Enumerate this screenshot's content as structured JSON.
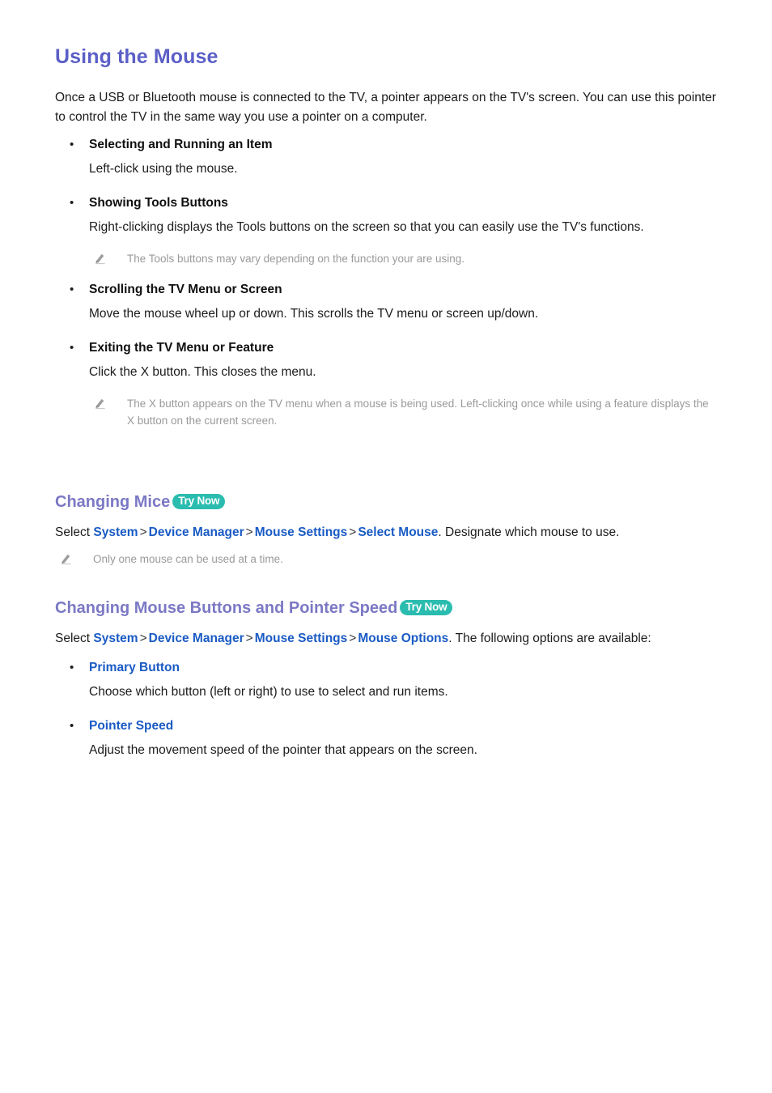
{
  "document": {
    "title": "Using the Mouse",
    "intro": "Once a USB or Bluetooth mouse is connected to the TV, a pointer appears on the TV's screen. You can use this pointer to control the TV in the same way you use a pointer on a computer."
  },
  "colors": {
    "title_purple": "#5b5fc7",
    "section_purple": "#7b79c4",
    "menu_link_blue": "#1a5bc4",
    "try_now_teal": "#2bbcb0",
    "note_gray": "#9a9a9a",
    "body_black": "#1c1c1c"
  },
  "icons": {
    "note": "pencil-icon",
    "bullet": "bullet-dot",
    "chevron": ">"
  },
  "bullets": [
    {
      "heading": "Selecting and Running an Item",
      "body": "Left-click using the mouse."
    },
    {
      "heading": "Showing Tools Buttons",
      "body": "Right-clicking displays the Tools buttons on the screen so that you can easily use the TV's functions.",
      "note": "The Tools buttons may vary depending on the function your are using."
    },
    {
      "heading": "Scrolling the TV Menu or Screen",
      "body": "Move the mouse wheel up or down. This scrolls the TV menu or screen up/down."
    },
    {
      "heading": "Exiting the TV Menu or Feature",
      "body": "Click the X button. This closes the menu.",
      "note": "The X button appears on the TV menu when a mouse is being used. Left-clicking once while using a feature displays the X button on the current screen."
    }
  ],
  "sections": [
    {
      "title": "Changing Mice",
      "badge": "Try Now",
      "path_prefix": "Select",
      "path": [
        "System",
        "Device Manager",
        "Mouse Settings",
        "Select Mouse"
      ],
      "path_suffix": ". Designate which mouse to use.",
      "note": "Only one mouse can be used at a time."
    },
    {
      "title": "Changing Mouse Buttons and Pointer Speed",
      "badge": "Try Now",
      "path_prefix": "Select",
      "path": [
        "System",
        "Device Manager",
        "Mouse Settings",
        "Mouse Options"
      ],
      "path_suffix": ". The following options are available:",
      "options": [
        {
          "heading": "Primary Button",
          "body": "Choose which button (left or right) to use to select and run items."
        },
        {
          "heading": "Pointer Speed",
          "body": "Adjust the movement speed of the pointer that appears on the screen."
        }
      ]
    }
  ]
}
